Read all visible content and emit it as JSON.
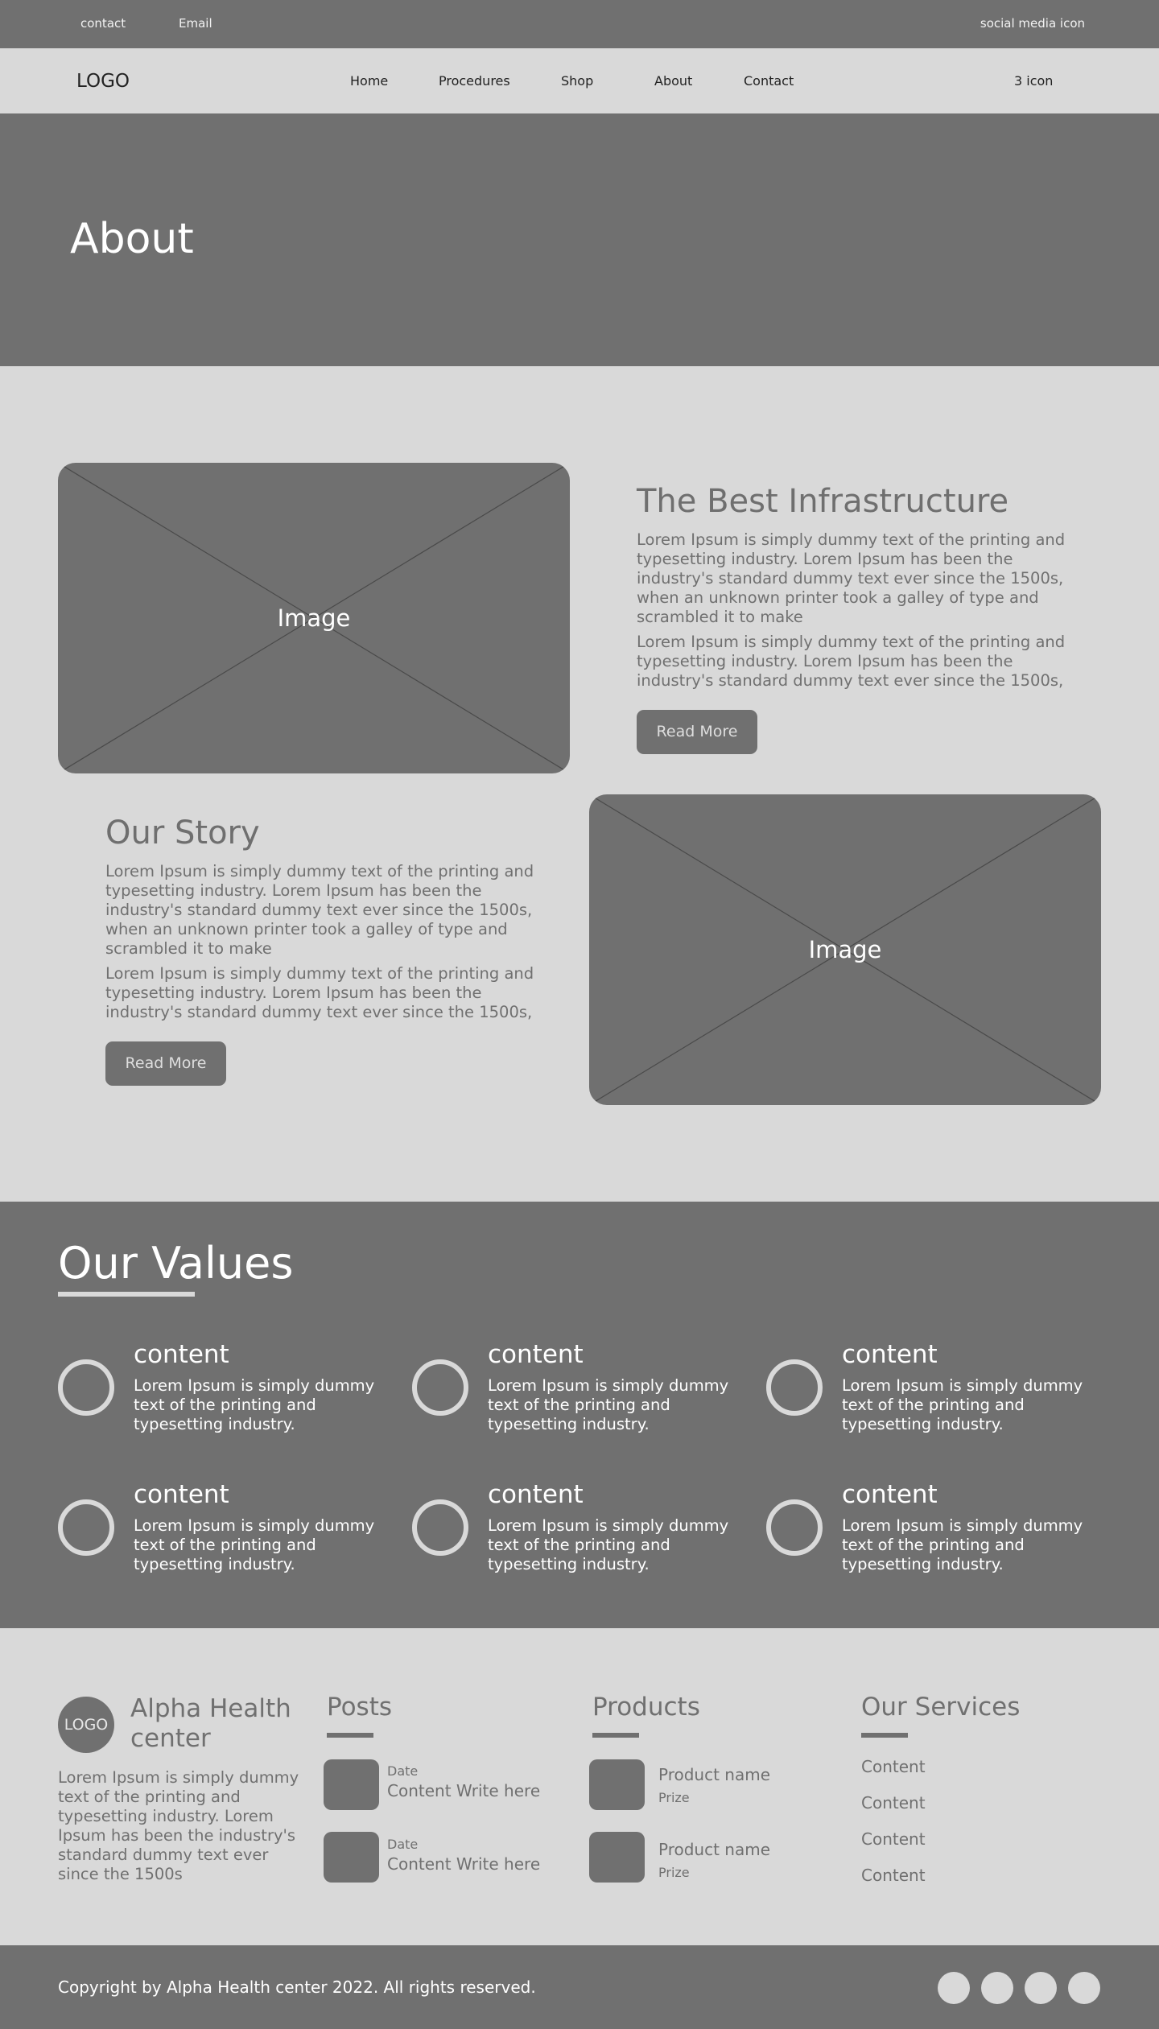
{
  "topbar": {
    "contact": "contact",
    "email": "Email",
    "social": "social media icon"
  },
  "nav": {
    "logo": "LOGO",
    "items": [
      "Home",
      "Procedures",
      "Shop",
      "About",
      "Contact"
    ],
    "icons": "3 icon"
  },
  "hero": {
    "title": "About"
  },
  "infra": {
    "image_label": "Image",
    "title": "The Best Infrastructure",
    "p1": "Lorem Ipsum is simply dummy text of the printing and typesetting industry. Lorem Ipsum has been the industry's standard dummy text ever since the 1500s, when an unknown printer took a galley of type and scrambled it to make",
    "p2": "Lorem Ipsum is simply dummy text of the printing and typesetting industry. Lorem Ipsum has been the industry's standard dummy text ever since the 1500s,",
    "button": "Read More"
  },
  "story": {
    "image_label": "Image",
    "title": "Our Story",
    "p1": "Lorem Ipsum is simply dummy text of the printing and typesetting industry. Lorem Ipsum has been the industry's standard dummy text ever since the 1500s, when an unknown printer took a galley of type and scrambled it to make",
    "p2": "Lorem Ipsum is simply dummy text of the printing and typesetting industry. Lorem Ipsum has been the industry's standard dummy text ever since the 1500s,",
    "button": "Read More"
  },
  "values": {
    "title": "Our Values",
    "items": [
      {
        "title": "content",
        "text": "Lorem Ipsum is simply dummy text of the printing and typesetting industry."
      },
      {
        "title": "content",
        "text": "Lorem Ipsum is simply dummy text of the printing and typesetting industry."
      },
      {
        "title": "content",
        "text": "Lorem Ipsum is simply dummy text of the printing and typesetting industry."
      },
      {
        "title": "content",
        "text": "Lorem Ipsum is simply dummy text of the printing and typesetting industry."
      },
      {
        "title": "content",
        "text": "Lorem Ipsum is simply dummy text of the printing and typesetting industry."
      },
      {
        "title": "content",
        "text": "Lorem Ipsum is simply dummy text of the printing and typesetting industry."
      }
    ]
  },
  "footer": {
    "logo": "LOGO",
    "brand": "Alpha Health center",
    "about": "Lorem Ipsum is simply dummy text of the printing and typesetting industry. Lorem Ipsum has been the industry's standard dummy text ever since the 1500s",
    "posts_title": "Posts",
    "posts": [
      {
        "date": "Date",
        "content": "Content Write here"
      },
      {
        "date": "Date",
        "content": "Content Write here"
      }
    ],
    "products_title": "Products",
    "products": [
      {
        "name": "Product name",
        "prize": "Prize"
      },
      {
        "name": "Product name",
        "prize": "Prize"
      }
    ],
    "services_title": "Our Services",
    "services": [
      "Content",
      "Content",
      "Content",
      "Content"
    ],
    "copyright": "Copyright by Alpha Health center 2022. All rights reserved."
  }
}
